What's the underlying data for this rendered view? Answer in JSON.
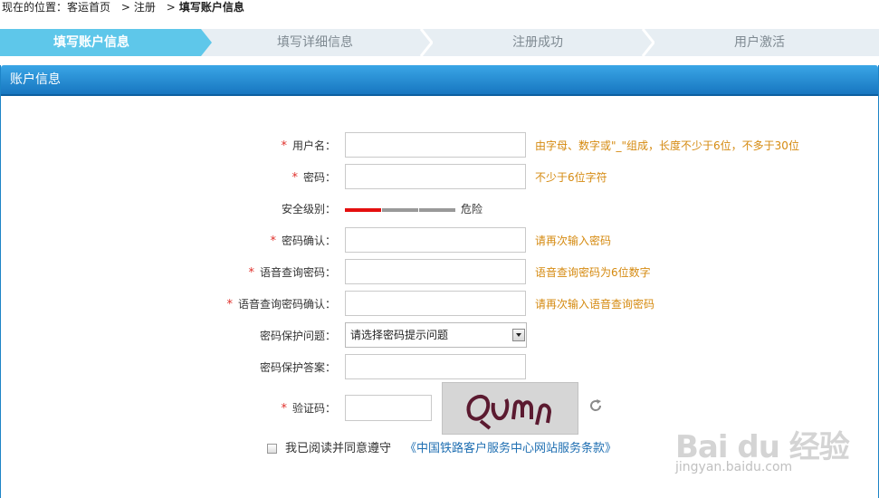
{
  "breadcrumb": {
    "prefix": "现在的位置：",
    "home": "客运首页",
    "sep1": ">",
    "register": "注册",
    "sep2": ">",
    "current": "填写账户信息"
  },
  "steps": [
    {
      "label": "填写账户信息",
      "active": true
    },
    {
      "label": "填写详细信息",
      "active": false
    },
    {
      "label": "注册成功",
      "active": false
    },
    {
      "label": "用户激活",
      "active": false
    }
  ],
  "panel": {
    "title": "账户信息"
  },
  "form": {
    "required_mark": "*",
    "username": {
      "label": "用户名：",
      "value": "",
      "hint": "由字母、数字或\"_\"组成，长度不少于6位，不多于30位"
    },
    "password": {
      "label": "密码：",
      "value": "",
      "hint": "不少于6位字符"
    },
    "strength": {
      "label": "安全级别：",
      "level_text": "危险",
      "level": 1,
      "max": 3
    },
    "password_confirm": {
      "label": "密码确认：",
      "value": "",
      "hint": "请再次输入密码"
    },
    "voice_password": {
      "label": "语音查询密码：",
      "value": "",
      "hint": "语音查询密码为6位数字"
    },
    "voice_password_confirm": {
      "label": "语音查询密码确认：",
      "value": "",
      "hint": "请再次输入语音查询密码"
    },
    "security_question": {
      "label": "密码保护问题：",
      "selected": "请选择密码提示问题"
    },
    "security_answer": {
      "label": "密码保护答案：",
      "value": ""
    },
    "captcha": {
      "label": "验证码：",
      "value": "",
      "image_text": "QUmn",
      "refresh_icon": "refresh-icon"
    },
    "agree": {
      "text": "我已阅读并同意遵守",
      "link": "《中国铁路客户服务中心网站服务条款》",
      "checked": false
    }
  },
  "watermark": {
    "brand": "Bai du 经验",
    "url": "jingyan.baidu.com"
  },
  "colors": {
    "active_step": "#5ec7ea",
    "panel_header": "#1776c0",
    "required": "#e0302b",
    "hint": "#d58a10",
    "strength_on": "#e40f0f",
    "link": "#1f6fb2"
  }
}
